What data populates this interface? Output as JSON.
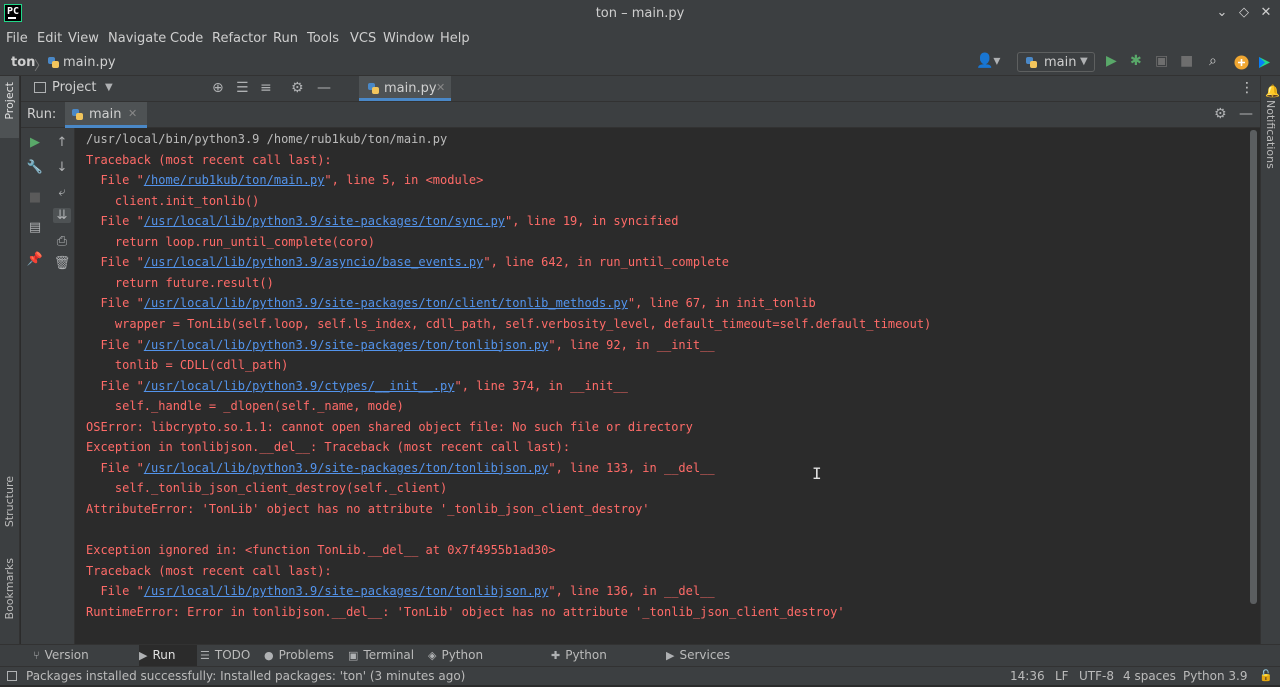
{
  "window": {
    "title": "ton – main.py",
    "controls": [
      "⌄",
      "◇",
      "✕"
    ]
  },
  "menu": [
    "File",
    "Edit",
    "View",
    "Navigate",
    "Code",
    "Refactor",
    "Run",
    "Tools",
    "VCS",
    "Window",
    "Help"
  ],
  "breadcrumb": {
    "project": "ton",
    "separator": "〉",
    "file": "main.py"
  },
  "run_config": {
    "label": "main"
  },
  "project_panel": {
    "label": "Project"
  },
  "editor_tab": {
    "label": "main.py"
  },
  "run_panel": {
    "label": "Run:",
    "tab": "main"
  },
  "left_strip": {
    "project": "Project",
    "structure": "Structure",
    "bookmarks": "Bookmarks"
  },
  "right_strip": {
    "notifications": "Notifications"
  },
  "console": {
    "lines": [
      {
        "parts": [
          {
            "t": "/usr/local/bin/python3.9 /home/rub1kub/ton/main.py"
          }
        ],
        "style": "normal"
      },
      {
        "parts": [
          {
            "t": "Traceback (most recent call last):"
          }
        ]
      },
      {
        "parts": [
          {
            "t": "  File \""
          },
          {
            "t": "/home/rub1kub/ton/main.py",
            "link": true
          },
          {
            "t": "\", line 5, in <module>"
          }
        ]
      },
      {
        "parts": [
          {
            "t": "    client.init_tonlib()"
          }
        ]
      },
      {
        "parts": [
          {
            "t": "  File \""
          },
          {
            "t": "/usr/local/lib/python3.9/site-packages/ton/sync.py",
            "link": true
          },
          {
            "t": "\", line 19, in syncified"
          }
        ]
      },
      {
        "parts": [
          {
            "t": "    return loop.run_until_complete(coro)"
          }
        ]
      },
      {
        "parts": [
          {
            "t": "  File \""
          },
          {
            "t": "/usr/local/lib/python3.9/asyncio/base_events.py",
            "link": true
          },
          {
            "t": "\", line 642, in run_until_complete"
          }
        ]
      },
      {
        "parts": [
          {
            "t": "    return future.result()"
          }
        ]
      },
      {
        "parts": [
          {
            "t": "  File \""
          },
          {
            "t": "/usr/local/lib/python3.9/site-packages/ton/client/tonlib_methods.py",
            "link": true
          },
          {
            "t": "\", line 67, in init_tonlib"
          }
        ]
      },
      {
        "parts": [
          {
            "t": "    wrapper = TonLib(self.loop, self.ls_index, cdll_path, self.verbosity_level, default_timeout=self.default_timeout)"
          }
        ]
      },
      {
        "parts": [
          {
            "t": "  File \""
          },
          {
            "t": "/usr/local/lib/python3.9/site-packages/ton/tonlibjson.py",
            "link": true
          },
          {
            "t": "\", line 92, in __init__"
          }
        ]
      },
      {
        "parts": [
          {
            "t": "    tonlib = CDLL(cdll_path)"
          }
        ]
      },
      {
        "parts": [
          {
            "t": "  File \""
          },
          {
            "t": "/usr/local/lib/python3.9/ctypes/__init__.py",
            "link": true
          },
          {
            "t": "\", line 374, in __init__"
          }
        ]
      },
      {
        "parts": [
          {
            "t": "    self._handle = _dlopen(self._name, mode)"
          }
        ]
      },
      {
        "parts": [
          {
            "t": "OSError: libcrypto.so.1.1: cannot open shared object file: No such file or directory"
          }
        ]
      },
      {
        "parts": [
          {
            "t": "Exception in tonlibjson.__del__: Traceback (most recent call last):"
          }
        ]
      },
      {
        "parts": [
          {
            "t": "  File \""
          },
          {
            "t": "/usr/local/lib/python3.9/site-packages/ton/tonlibjson.py",
            "link": true
          },
          {
            "t": "\", line 133, in __del__"
          }
        ]
      },
      {
        "parts": [
          {
            "t": "    self._tonlib_json_client_destroy(self._client)"
          }
        ]
      },
      {
        "parts": [
          {
            "t": "AttributeError: 'TonLib' object has no attribute '_tonlib_json_client_destroy'"
          }
        ]
      },
      {
        "parts": [
          {
            "t": ""
          }
        ]
      },
      {
        "parts": [
          {
            "t": "Exception ignored in: <function TonLib.__del__ at 0x7f4955b1ad30>"
          }
        ]
      },
      {
        "parts": [
          {
            "t": "Traceback (most recent call last):"
          }
        ]
      },
      {
        "parts": [
          {
            "t": "  File \""
          },
          {
            "t": "/usr/local/lib/python3.9/site-packages/ton/tonlibjson.py",
            "link": true
          },
          {
            "t": "\", line 136, in __del__"
          }
        ]
      },
      {
        "parts": [
          {
            "t": "RuntimeError: Error in tonlibjson.__del__: 'TonLib' object has no attribute '_tonlib_json_client_destroy'"
          }
        ]
      }
    ]
  },
  "bottom_tabs": [
    {
      "label": "Version Control",
      "icon": "branch-icon"
    },
    {
      "label": "Run",
      "icon": "play-icon",
      "active": true
    },
    {
      "label": "TODO",
      "icon": "list-icon"
    },
    {
      "label": "Problems",
      "icon": "problems-icon"
    },
    {
      "label": "Terminal",
      "icon": "terminal-icon"
    },
    {
      "label": "Python Packages",
      "icon": "packages-icon"
    },
    {
      "label": "Python Console",
      "icon": "python-console-icon"
    },
    {
      "label": "Services",
      "icon": "services-icon"
    }
  ],
  "status": {
    "message": "Packages installed successfully: Installed packages: 'ton' (3 minutes ago)",
    "position": "14:36",
    "line_sep": "LF",
    "encoding": "UTF-8",
    "indent": "4 spaces",
    "interpreter": "Python 3.9"
  },
  "colors": {
    "error_text": "#ff6b68",
    "link": "#5394ec",
    "accent": "#4a88c7",
    "run_green": "#59a869"
  }
}
